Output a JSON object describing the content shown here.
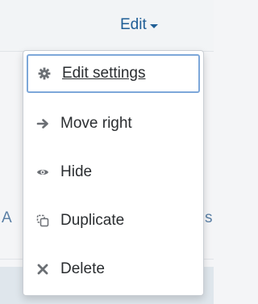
{
  "header": {
    "edit_label": "Edit"
  },
  "background": {
    "partial_left": "A",
    "partial_right": "s"
  },
  "menu": {
    "items": [
      {
        "label": "Edit settings",
        "icon": "gear-icon"
      },
      {
        "label": "Move right",
        "icon": "arrow-right-icon"
      },
      {
        "label": "Hide",
        "icon": "eye-icon"
      },
      {
        "label": "Duplicate",
        "icon": "duplicate-icon"
      },
      {
        "label": "Delete",
        "icon": "close-icon"
      }
    ]
  },
  "colors": {
    "link": "#1f5e96",
    "icon": "#6b6f74",
    "focus_border": "#7da7d9"
  }
}
